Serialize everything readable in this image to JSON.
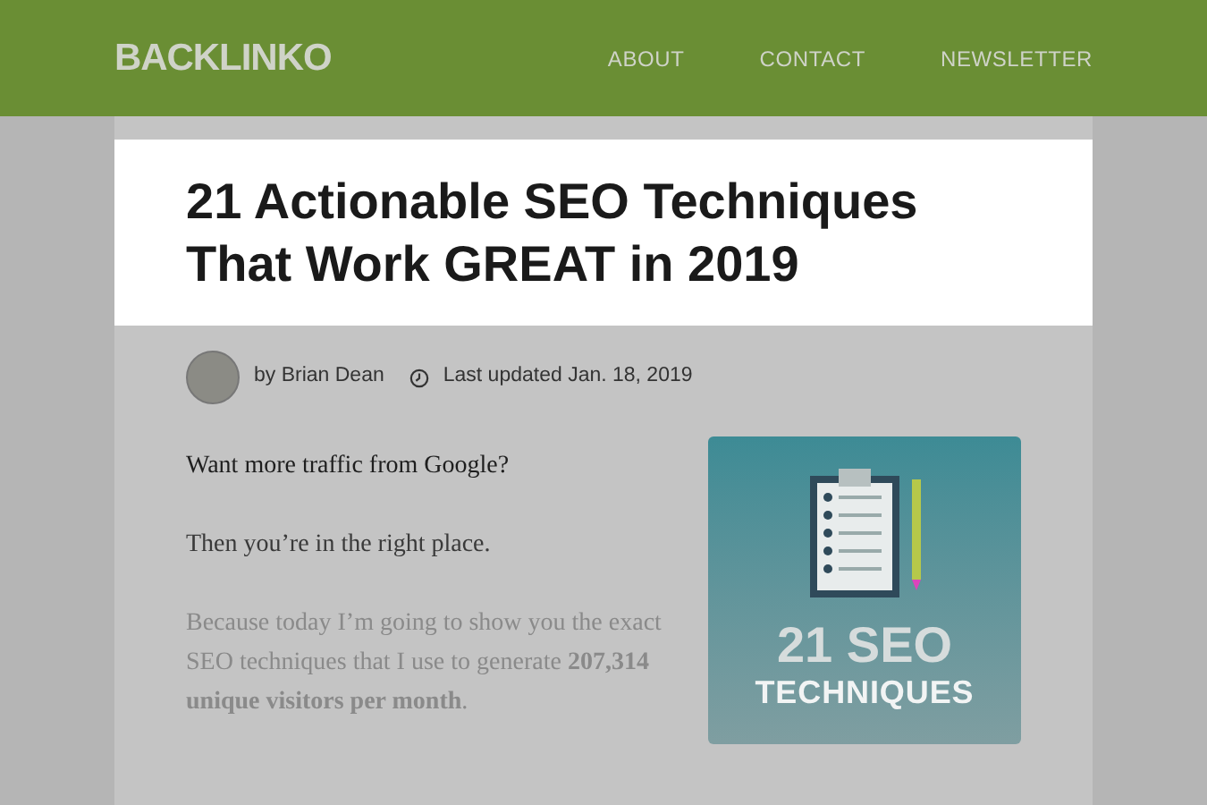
{
  "header": {
    "logo": "BACKLINKO",
    "nav": [
      "ABOUT",
      "CONTACT",
      "NEWSLETTER"
    ]
  },
  "article": {
    "title": "21 Actionable SEO Techniques That Work GREAT in 2019",
    "author": "by Brian Dean",
    "updated": "Last updated Jan. 18, 2019",
    "paragraphs": [
      "Want more traffic from Google?",
      "Then you’re in the right place.",
      "Because today I’m going to show you the exact SEO techniques that I use to generate **207,314 unique visitors per month**."
    ],
    "cover": {
      "line1": "21 SEO",
      "line2": "TECHNIQUES"
    }
  }
}
